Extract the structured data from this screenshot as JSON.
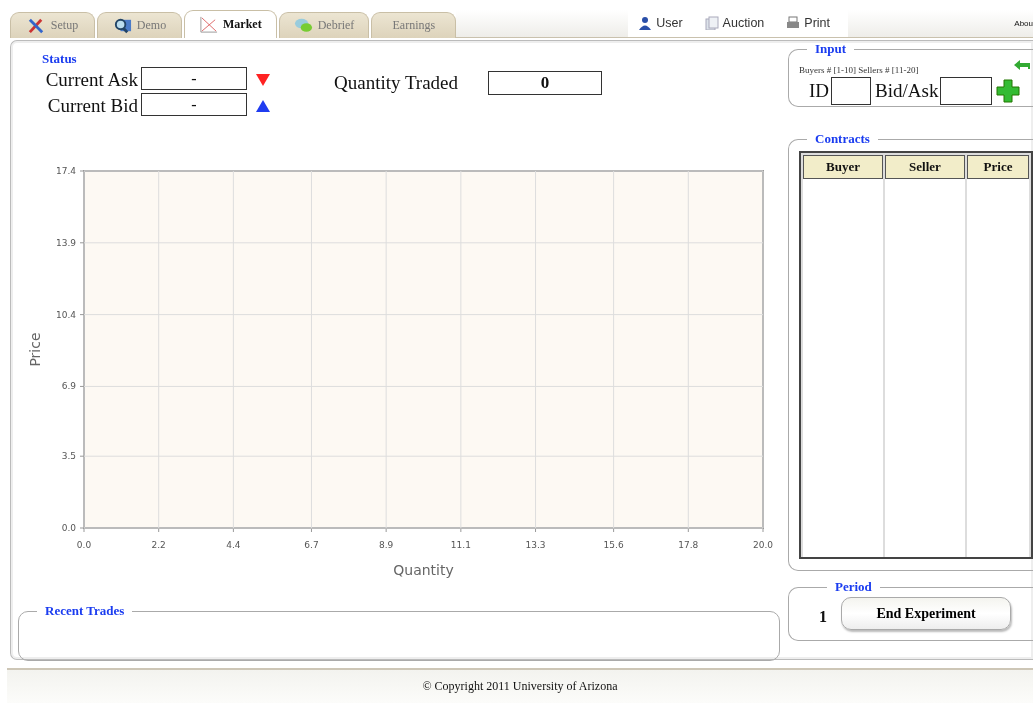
{
  "tabs": [
    {
      "label": "Setup",
      "selected": false
    },
    {
      "label": "Demo",
      "selected": false
    },
    {
      "label": "Market",
      "selected": true
    },
    {
      "label": "Debrief",
      "selected": false
    },
    {
      "label": "Earnings",
      "selected": false
    }
  ],
  "nav": [
    {
      "label": "User"
    },
    {
      "label": "Auction"
    },
    {
      "label": "Print"
    }
  ],
  "about_link": "Abou",
  "status": {
    "legend": "Status",
    "ask_label": "Current Ask",
    "ask_value": "-",
    "bid_label": "Current Bid",
    "bid_value": "-",
    "qty_label": "Quantity Traded",
    "qty_value": "0"
  },
  "chart": {
    "chart_data": {
      "type": "line",
      "xlabel": "Quantity",
      "ylabel": "Price",
      "grid": true,
      "xlim": [
        0,
        20
      ],
      "ylim": [
        0,
        17.4
      ],
      "xticks": [
        {
          "value": 0,
          "label": "0.0"
        },
        {
          "value": 2.2,
          "label": "2.2"
        },
        {
          "value": 4.4,
          "label": "4.4"
        },
        {
          "value": 6.7,
          "label": "6.7"
        },
        {
          "value": 8.9,
          "label": "8.9"
        },
        {
          "value": 11.1,
          "label": "11.1"
        },
        {
          "value": 13.3,
          "label": "13.3"
        },
        {
          "value": 15.6,
          "label": "15.6"
        },
        {
          "value": 17.8,
          "label": "17.8"
        },
        {
          "value": 20,
          "label": "20.0"
        }
      ],
      "yticks": [
        {
          "value": 0,
          "label": "0.0"
        },
        {
          "value": 3.5,
          "label": "3.5"
        },
        {
          "value": 6.9,
          "label": "6.9"
        },
        {
          "value": 10.4,
          "label": "10.4"
        },
        {
          "value": 13.9,
          "label": "13.9"
        },
        {
          "value": 17.4,
          "label": "17.4"
        }
      ]
    }
  },
  "recent_trades": {
    "legend": "Recent Trades"
  },
  "input": {
    "legend": "Input",
    "hint": "Buyers # [1-10] Sellers # [11-20]",
    "id_label": "ID",
    "bid_label": "Bid/Ask"
  },
  "contracts": {
    "legend": "Contracts",
    "columns": [
      "Buyer",
      "Seller",
      "Price"
    ]
  },
  "period": {
    "legend": "Period",
    "value": "1",
    "button": "End Experiment"
  },
  "footer": "© Copyright 2011 University of Arizona"
}
